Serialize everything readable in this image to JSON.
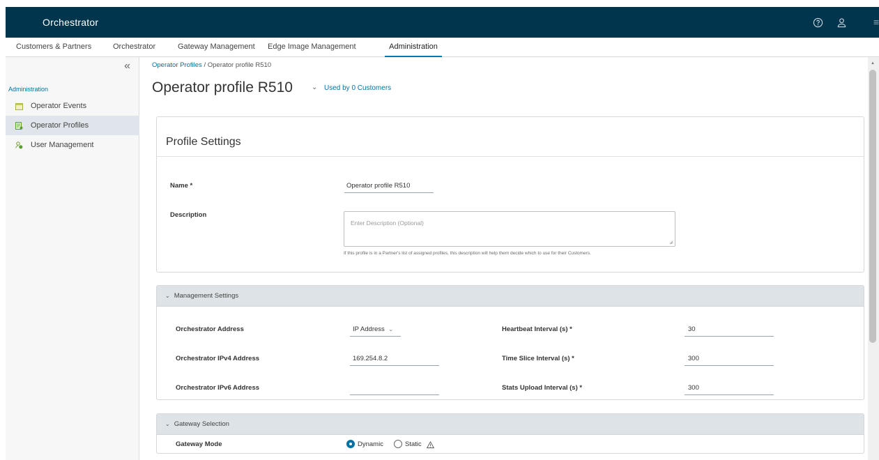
{
  "app": {
    "title": "Orchestrator"
  },
  "nav": {
    "tabs": [
      {
        "label": "Customers & Partners"
      },
      {
        "label": "Orchestrator"
      },
      {
        "label": "Gateway Management"
      },
      {
        "label": "Edge Image Management"
      },
      {
        "label": "Administration",
        "active": true
      }
    ]
  },
  "sidebar": {
    "heading": "Administration",
    "items": [
      {
        "label": "Operator Events",
        "icon": "calendar-icon"
      },
      {
        "label": "Operator Profiles",
        "icon": "profile-icon",
        "active": true
      },
      {
        "label": "User Management",
        "icon": "users-icon"
      }
    ]
  },
  "breadcrumb": {
    "link": "Operator Profiles",
    "separator": " / ",
    "current": "Operator profile R510"
  },
  "page": {
    "title": "Operator profile R510",
    "used_by": "Used by 0 Customers"
  },
  "profile_settings": {
    "heading": "Profile Settings",
    "name_label": "Name *",
    "name_value": "Operator profile R510",
    "description_label": "Description",
    "description_placeholder": "Enter Description (Optional)",
    "description_helper": "If this profile is in a Partner's list of assigned profiles, this description will help them decide which to use for their Customers."
  },
  "management_settings": {
    "heading": "Management Settings",
    "orch_address_label": "Orchestrator Address",
    "orch_address_value": "IP Address",
    "ipv4_label": "Orchestrator IPv4 Address",
    "ipv4_value": "169.254.8.2",
    "ipv6_label": "Orchestrator IPv6 Address",
    "ipv6_value": "",
    "heartbeat_label": "Heartbeat Interval (s) *",
    "heartbeat_value": "30",
    "timeslice_label": "Time Slice Interval (s) *",
    "timeslice_value": "300",
    "stats_label": "Stats Upload Interval (s) *",
    "stats_value": "300"
  },
  "gateway_selection": {
    "heading": "Gateway Selection",
    "mode_label": "Gateway Mode",
    "options": [
      {
        "label": "Dynamic",
        "selected": true
      },
      {
        "label": "Static",
        "selected": false
      }
    ]
  },
  "colors": {
    "header_bg": "#00364d",
    "accent": "#0072a3"
  }
}
